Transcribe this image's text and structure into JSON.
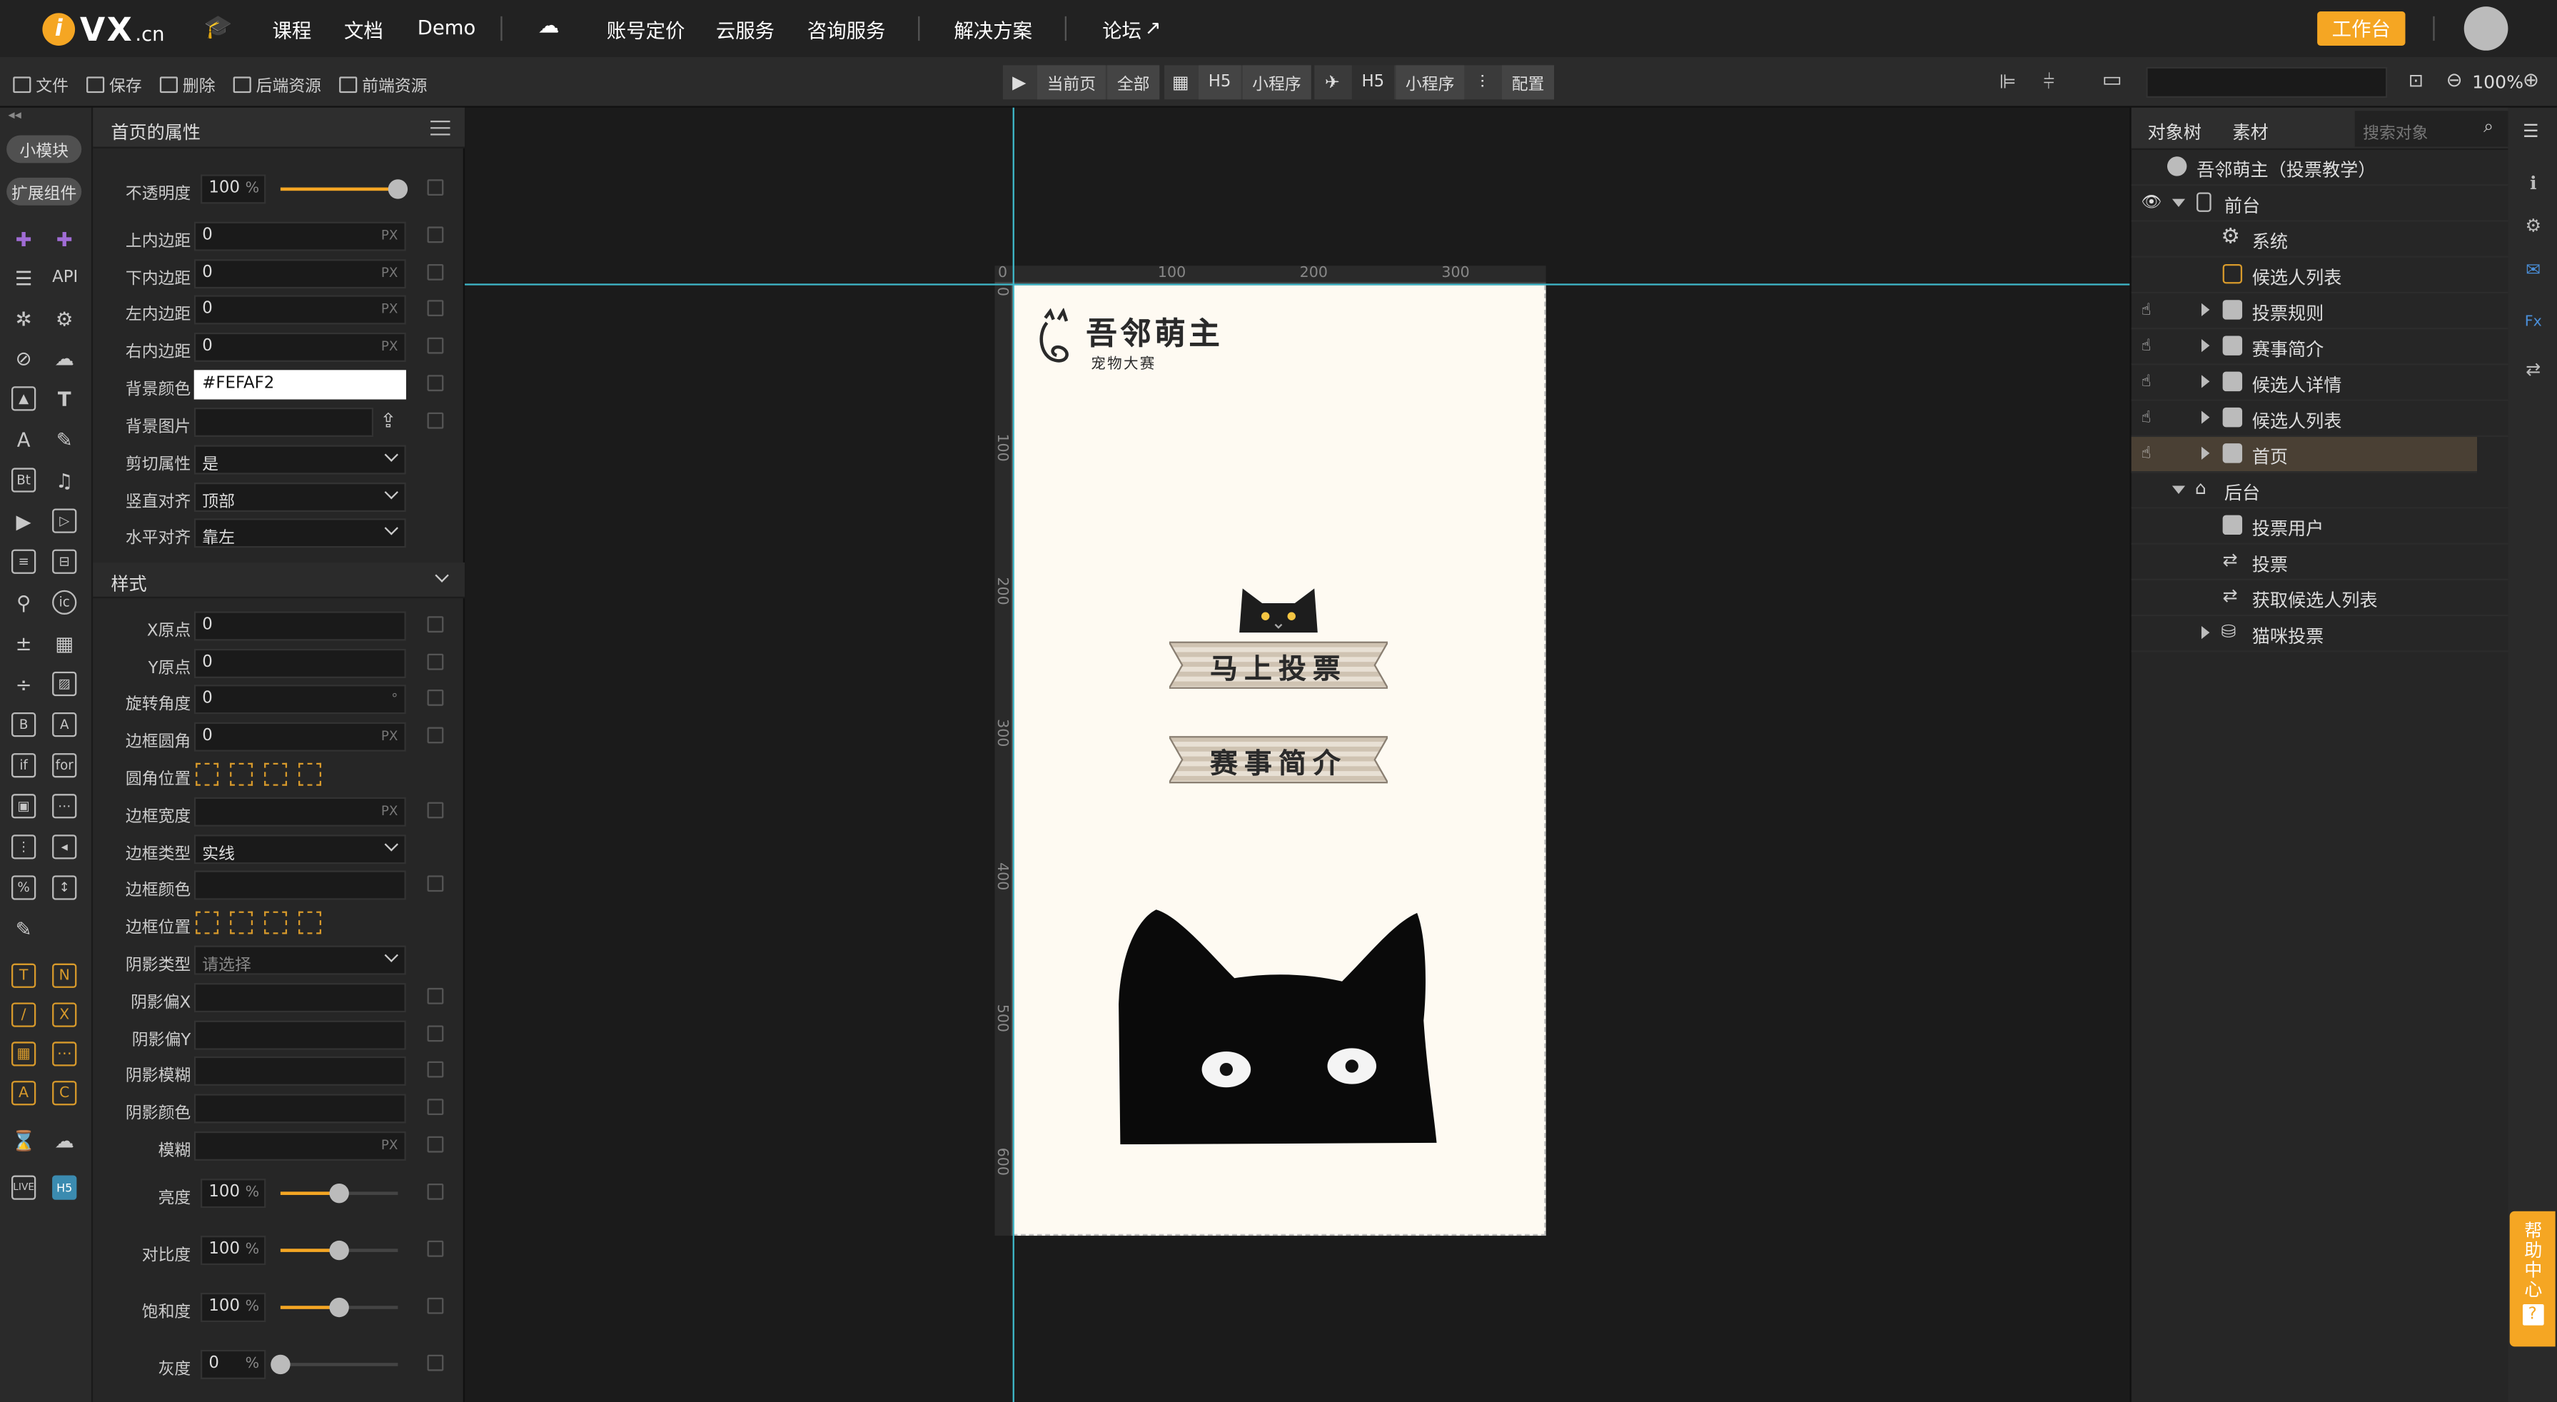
{
  "nav": {
    "logo": "VX",
    "logo_suffix": ".cn",
    "items": [
      "课程",
      "文档",
      "Demo",
      "账号定价",
      "云服务",
      "咨询服务",
      "解决方案",
      "论坛"
    ],
    "work_button": "工作台"
  },
  "toolbar": {
    "file": "文件",
    "save": "保存",
    "delete": "删除",
    "backend": "后端资源",
    "frontend": "前端资源",
    "current_page": "当前页",
    "all": "全部",
    "h5": "H5",
    "mini": "小程序",
    "config": "配置",
    "zoom": "100%"
  },
  "left": {
    "pill1": "小模块",
    "pill2": "扩展组件",
    "api": "API"
  },
  "props": {
    "title": "首页的属性",
    "rows": {
      "opacity": {
        "label": "不透明度",
        "value": "100",
        "unit": "%",
        "level": 1.0
      },
      "pad_top": {
        "label": "上内边距",
        "value": "0",
        "unit": "PX"
      },
      "pad_bottom": {
        "label": "下内边距",
        "value": "0",
        "unit": "PX"
      },
      "pad_left": {
        "label": "左内边距",
        "value": "0",
        "unit": "PX"
      },
      "pad_right": {
        "label": "右内边距",
        "value": "0",
        "unit": "PX"
      },
      "bg_color": {
        "label": "背景颜色",
        "value": "#FEFAF2"
      },
      "bg_image": {
        "label": "背景图片",
        "value": ""
      },
      "clip": {
        "label": "剪切属性",
        "value": "是"
      },
      "valign": {
        "label": "竖直对齐",
        "value": "顶部"
      },
      "halign": {
        "label": "水平对齐",
        "value": "靠左"
      }
    },
    "style_section": "样式",
    "style": {
      "x_origin": {
        "label": "X原点",
        "value": "0"
      },
      "y_origin": {
        "label": "Y原点",
        "value": "0"
      },
      "rotate": {
        "label": "旋转角度",
        "value": "0",
        "unit": "°"
      },
      "radius": {
        "label": "边框圆角",
        "value": "0",
        "unit": "PX"
      },
      "radius_pos": {
        "label": "圆角位置"
      },
      "border_width": {
        "label": "边框宽度",
        "value": "",
        "unit": "PX"
      },
      "border_type": {
        "label": "边框类型",
        "value": "实线"
      },
      "border_color": {
        "label": "边框颜色",
        "value": ""
      },
      "border_pos": {
        "label": "边框位置"
      },
      "shadow_type": {
        "label": "阴影类型",
        "value": "请选择"
      },
      "shadow_x": {
        "label": "阴影偏X",
        "value": ""
      },
      "shadow_y": {
        "label": "阴影偏Y",
        "value": ""
      },
      "shadow_blur": {
        "label": "阴影模糊",
        "value": ""
      },
      "shadow_color": {
        "label": "阴影颜色",
        "value": ""
      },
      "blur": {
        "label": "模糊",
        "value": "",
        "unit": "PX"
      },
      "brightness": {
        "label": "亮度",
        "value": "100",
        "unit": "%",
        "level": 0.5
      },
      "contrast": {
        "label": "对比度",
        "value": "100",
        "unit": "%",
        "level": 0.5
      },
      "saturate": {
        "label": "饱和度",
        "value": "100",
        "unit": "%",
        "level": 0.5
      },
      "grayscale": {
        "label": "灰度",
        "value": "0",
        "unit": "%",
        "level": 0.0
      }
    }
  },
  "canvas": {
    "ruler_top": [
      "0",
      "100",
      "200",
      "300"
    ],
    "ruler_left": [
      "0",
      "100",
      "200",
      "300",
      "400",
      "500",
      "600"
    ],
    "brand_title": "吾邻萌主",
    "brand_sub": "宠物大赛",
    "vote_button": "马上投票",
    "intro_button": "赛事简介",
    "bg_color": "#FEFAF2"
  },
  "tree": {
    "tab_objects": "对象树",
    "tab_assets": "素材",
    "search_placeholder": "搜索对象",
    "items": [
      {
        "label": "吾邻萌主（投票教学）"
      },
      {
        "label": "前台"
      },
      {
        "label": "系统"
      },
      {
        "label": "候选人列表"
      },
      {
        "label": "投票规则"
      },
      {
        "label": "赛事简介"
      },
      {
        "label": "候选人详情"
      },
      {
        "label": "候选人列表"
      },
      {
        "label": "首页"
      },
      {
        "label": "后台"
      },
      {
        "label": "投票用户"
      },
      {
        "label": "投票"
      },
      {
        "label": "获取候选人列表"
      },
      {
        "label": "猫咪投票"
      }
    ]
  },
  "help": "帮助中心"
}
